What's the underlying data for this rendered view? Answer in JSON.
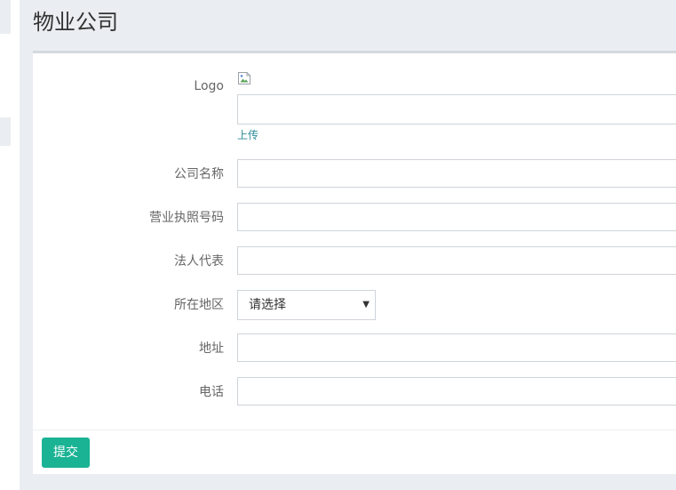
{
  "page": {
    "title": "物业公司"
  },
  "form": {
    "logo": {
      "label": "Logo",
      "value": "",
      "upload_label": "上传"
    },
    "company_name": {
      "label": "公司名称",
      "value": ""
    },
    "license_number": {
      "label": "营业执照号码",
      "value": ""
    },
    "legal_representative": {
      "label": "法人代表",
      "value": ""
    },
    "region": {
      "label": "所在地区",
      "selected": "请选择"
    },
    "address": {
      "label": "地址",
      "value": ""
    },
    "phone": {
      "label": "电话",
      "value": ""
    },
    "submit_label": "提交"
  },
  "colors": {
    "background": "#eaedf1",
    "submit_button": "#1ab394",
    "link": "#2b8a98"
  },
  "icons": {
    "logo_image": "broken-image-icon",
    "region_select": "caret-down-icon"
  }
}
